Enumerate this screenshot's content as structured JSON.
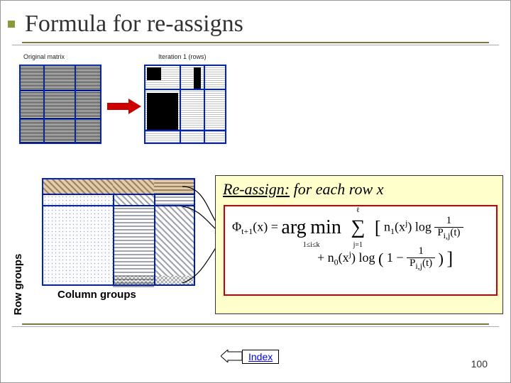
{
  "title": "Formula for re-assigns",
  "matrices": {
    "left_label": "Original matrix",
    "right_label": "Iteration 1 (rows)"
  },
  "cluster": {
    "row_label": "Row groups",
    "col_label": "Column groups"
  },
  "callout": {
    "lead": "Re-assign:",
    "rest": " for each row x"
  },
  "formula": {
    "lhs": "Φ",
    "lhs_sub": "t+1",
    "arg": "(x) = ",
    "argmin": "arg min",
    "argmin_range": "1≤i≤k",
    "sum_top": "ℓ",
    "sum_bot": "j=1",
    "term1_pre": "n",
    "term1_sub": "1",
    "term1_arg": "(x",
    "term1_sup": "j",
    "term1_close": ") log ",
    "frac1_num": "1",
    "frac1_den_base": "P",
    "frac1_den_sub": "i,j",
    "frac1_den_t": "(t)",
    "plus": "+ n",
    "term2_sub": "0",
    "term2_arg": "(x",
    "term2_sup": "j",
    "term2_close": ") log ",
    "paren_open": "(",
    "one_minus": "1 − ",
    "paren_close": ")",
    "br_open": "[",
    "br_close": "]"
  },
  "footer": {
    "index_label": "Index",
    "page_number": "100"
  }
}
